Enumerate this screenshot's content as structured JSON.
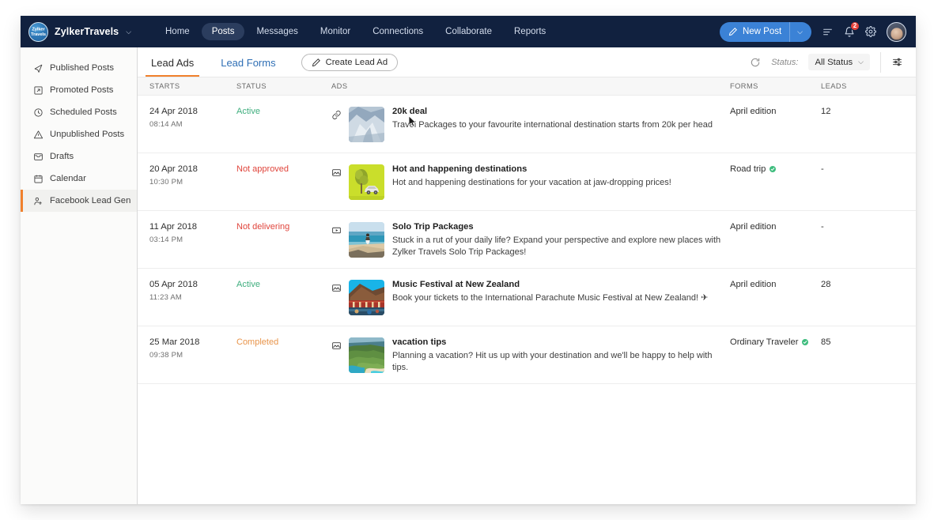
{
  "topnav": {
    "brand_logo_text": "Zylker Travels",
    "brand_name": "ZylkerTravels",
    "brand_caret": "⌵",
    "links": [
      {
        "label": "Home",
        "active": false
      },
      {
        "label": "Posts",
        "active": true
      },
      {
        "label": "Messages",
        "active": false
      },
      {
        "label": "Monitor",
        "active": false
      },
      {
        "label": "Connections",
        "active": false
      },
      {
        "label": "Collaborate",
        "active": false
      },
      {
        "label": "Reports",
        "active": false
      }
    ],
    "new_post_label": "New Post",
    "new_post_caret": "⌵",
    "notification_count": "2",
    "accent_color": "#3b82d6",
    "bar_color": "#11213f"
  },
  "sidebar": {
    "items": [
      {
        "label": "Published Posts",
        "icon": "rocket-icon",
        "active": false
      },
      {
        "label": "Promoted Posts",
        "icon": "promoted-icon",
        "active": false
      },
      {
        "label": "Scheduled Posts",
        "icon": "clock-icon",
        "active": false
      },
      {
        "label": "Unpublished Posts",
        "icon": "warning-icon",
        "active": false
      },
      {
        "label": "Drafts",
        "icon": "drafts-icon",
        "active": false
      },
      {
        "label": "Calendar",
        "icon": "calendar-icon",
        "active": false
      },
      {
        "label": "Facebook Lead Gen",
        "icon": "lead-gen-icon",
        "active": true
      }
    ],
    "active_accent": "#f0802c"
  },
  "toolbar": {
    "tabs": [
      {
        "label": "Lead Ads",
        "active": true
      },
      {
        "label": "Lead Forms",
        "active": false
      }
    ],
    "create_button": "Create Lead Ad",
    "refresh_icon": "refresh-icon",
    "status_label": "Status:",
    "status_value": "All Status",
    "status_caret": "⌵",
    "filter_icon": "filter-sliders-icon"
  },
  "table": {
    "columns": [
      "STARTS",
      "STATUS",
      "ADS",
      "FORMS",
      "LEADS"
    ],
    "rows": [
      {
        "date": "24 Apr 2018",
        "time": "08:14 AM",
        "status": "Active",
        "status_kind": "active",
        "ad_type_icon": "link-icon",
        "thumb": "snowy-mountain-thumbnail",
        "title": "20k deal",
        "desc": "Travel Packages to your favourite international destination starts from 20k per head",
        "form": "April edition",
        "form_verified": false,
        "leads": "12"
      },
      {
        "date": "20 Apr 2018",
        "time": "10:30 PM",
        "status": "Not approved",
        "status_kind": "red",
        "ad_type_icon": "image-icon",
        "thumb": "tree-car-illustration-thumbnail",
        "title": "Hot and happening destinations",
        "desc": "Hot and happening destinations for your vacation at jaw-dropping prices!",
        "form": "Road trip",
        "form_verified": true,
        "leads": "-"
      },
      {
        "date": "11 Apr 2018",
        "time": "03:14 PM",
        "status": "Not delivering",
        "status_kind": "red",
        "ad_type_icon": "video-icon",
        "thumb": "beach-walker-thumbnail",
        "title": "Solo Trip Packages",
        "desc": "Stuck in a rut of your daily life? Expand your perspective and explore new places with Zylker Travels Solo Trip Packages!",
        "form": "April edition",
        "form_verified": false,
        "leads": "-"
      },
      {
        "date": "05 Apr 2018",
        "time": "11:23 AM",
        "status": "Active",
        "status_kind": "active",
        "ad_type_icon": "image-icon",
        "thumb": "thatched-hut-thumbnail",
        "title": "Music Festival at New Zealand",
        "desc": "Book your tickets to the International Parachute Music Festival at New Zealand! ✈",
        "form": "April edition",
        "form_verified": false,
        "leads": "28"
      },
      {
        "date": "25 Mar 2018",
        "time": "09:38 PM",
        "status": "Completed",
        "status_kind": "orange",
        "ad_type_icon": "image-icon",
        "thumb": "island-coast-thumbnail",
        "title": "vacation tips",
        "desc": "Planning a vacation? Hit us up with your destination and we'll be happy to help with tips.",
        "form": "Ordinary Traveler",
        "form_verified": true,
        "leads": "85"
      }
    ]
  },
  "status_colors": {
    "active": "#3fae7e",
    "red": "#e0453c",
    "orange": "#e8944a"
  }
}
